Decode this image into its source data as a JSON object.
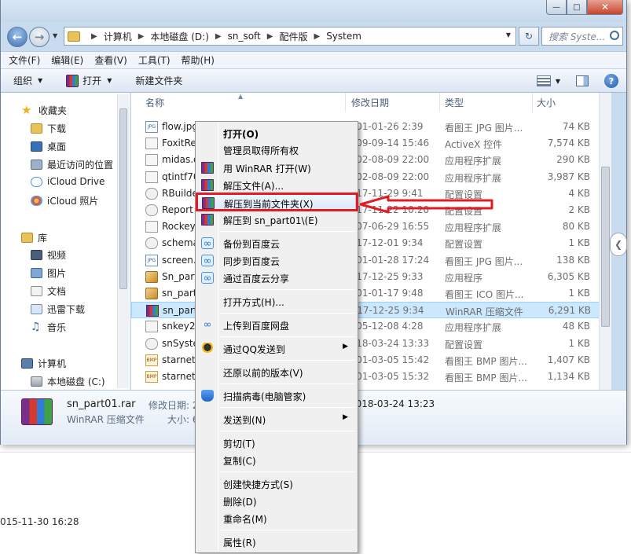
{
  "background": {
    "date_text": "015-11-30 16:28"
  },
  "titlebar": {
    "min": "—",
    "max": "□",
    "close": "✕"
  },
  "address": {
    "crumbs": [
      "计算机",
      "本地磁盘 (D:)",
      "sn_soft",
      "配件版",
      "System"
    ],
    "search_placeholder": "搜索 Syste..."
  },
  "menubar": [
    "文件(F)",
    "编辑(E)",
    "查看(V)",
    "工具(T)",
    "帮助(H)"
  ],
  "commands": {
    "organize": "组织",
    "open": "打开",
    "new_folder": "新建文件夹"
  },
  "nav": {
    "favorites": "收藏夹",
    "items": [
      "下载",
      "桌面",
      "最近访问的位置",
      "iCloud Drive",
      "iCloud 照片"
    ],
    "library": "库",
    "lib_items": [
      "视频",
      "图片",
      "文档",
      "迅雷下载",
      "音乐"
    ],
    "computer": "计算机",
    "drive": "本地磁盘 (C:)"
  },
  "columns": {
    "name": "名称",
    "date": "修改日期",
    "type": "类型",
    "size": "大小"
  },
  "files": [
    {
      "name": "flow.jpg",
      "date": "2001-01-26 2:39",
      "type": "看图王 JPG 图片...",
      "size": "74 KB",
      "icon": "jpg"
    },
    {
      "name": "FoxitRea",
      "date": "2009-09-14 15:46",
      "type": "ActiveX 控件",
      "size": "7,574 KB",
      "icon": "dll"
    },
    {
      "name": "midas.d",
      "date": "2002-08-09 22:00",
      "type": "应用程序扩展",
      "size": "290 KB",
      "icon": "dll"
    },
    {
      "name": "qtintf70",
      "date": "2002-08-09 22:00",
      "type": "应用程序扩展",
      "size": "3,987 KB",
      "icon": "dll"
    },
    {
      "name": "RBuilde",
      "date": "2017-11-29 9:41",
      "type": "配置设置",
      "size": "4 KB",
      "icon": "cfg"
    },
    {
      "name": "Report",
      "date": "2017-11-22 10:20",
      "type": "配置设置",
      "size": "2 KB",
      "icon": "cfg"
    },
    {
      "name": "Rockey4",
      "date": "2007-06-29 16:55",
      "type": "应用程序扩展",
      "size": "80 KB",
      "icon": "dll"
    },
    {
      "name": "schema",
      "date": "2017-12-01 9:34",
      "type": "配置设置",
      "size": "1 KB",
      "icon": "cfg"
    },
    {
      "name": "screen.jp",
      "date": "2001-01-28 17:24",
      "type": "看图王 JPG 图片...",
      "size": "138 KB",
      "icon": "jpg"
    },
    {
      "name": "Sn_part",
      "date": "2017-12-25 9:33",
      "type": "应用程序",
      "size": "6,305 KB",
      "icon": "img"
    },
    {
      "name": "sn_part.",
      "date": "2001-01-17 9:48",
      "type": "看图王 ICO 图片...",
      "size": "1 KB",
      "icon": "img"
    },
    {
      "name": "sn_part0",
      "date": "2017-12-25 9:34",
      "type": "WinRAR 压缩文件",
      "size": "6,291 KB",
      "icon": "rar",
      "selected": true
    },
    {
      "name": "snkey2.",
      "date": "2005-12-08 4:28",
      "type": "应用程序扩展",
      "size": "48 KB",
      "icon": "dll"
    },
    {
      "name": "snSyste",
      "date": "2018-03-24 13:33",
      "type": "配置设置",
      "size": "1 KB",
      "icon": "cfg"
    },
    {
      "name": "starnet1",
      "date": "2001-03-05 15:42",
      "type": "看图王 BMP 图片...",
      "size": "1,407 KB",
      "icon": "bmp"
    },
    {
      "name": "starnet2",
      "date": "2001-03-05 15:32",
      "type": "看图王 BMP 图片...",
      "size": "1,134 KB",
      "icon": "bmp"
    }
  ],
  "details": {
    "name": "sn_part01.rar",
    "type": "WinRAR 压缩文件",
    "modified_label": "修改日期: 2",
    "size_label": "大小: 6",
    "modified_value": "2018-03-24 13:23"
  },
  "context_menu": {
    "open": "打开(O)",
    "admin": "管理员取得所有权",
    "winrar_open": "用 WinRAR 打开(W)",
    "extract": "解压文件(A)...",
    "extract_here": "解压到当前文件夹(X)",
    "extract_to": "解压到 sn_part01\\(E)",
    "backup_baidu": "备份到百度云",
    "sync_baidu": "同步到百度云",
    "share_baidu": "通过百度云分享",
    "open_with": "打开方式(H)...",
    "upload_baidu": "上传到百度网盘",
    "send_qq": "通过QQ发送到",
    "restore": "还原以前的版本(V)",
    "scan": "扫描病毒(电脑管家)",
    "send_to": "发送到(N)",
    "cut": "剪切(T)",
    "copy": "复制(C)",
    "shortcut": "创建快捷方式(S)",
    "delete": "删除(D)",
    "rename": "重命名(M)",
    "properties": "属性(R)"
  },
  "colors": {
    "annotation": "#e51b23",
    "selection": "#cce8ff"
  }
}
